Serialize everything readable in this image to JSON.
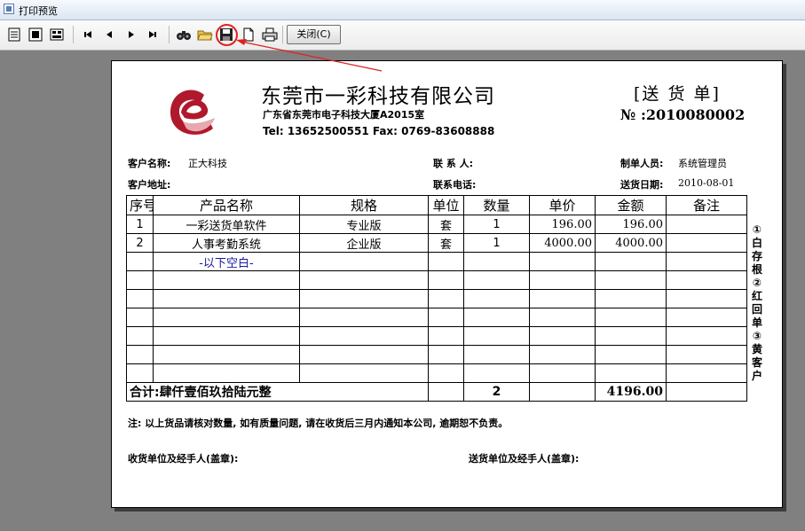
{
  "window": {
    "title": "打印预览"
  },
  "toolbar": {
    "close_label": "关闭(C)",
    "icons": [
      "single-page-icon",
      "two-page-icon",
      "multi-page-icon",
      "first-page-icon",
      "prev-page-icon",
      "next-page-icon",
      "last-page-icon",
      "find-icon",
      "open-folder-icon",
      "save-icon",
      "new-page-icon",
      "printer-icon"
    ]
  },
  "colors": {
    "highlight": "#e02020",
    "logo": "#b0182c",
    "background": "#808080"
  },
  "document": {
    "company_name": "东莞市一彩科技有限公司",
    "company_address": "广东省东莞市电子科技大厦A2015室",
    "company_contact": "Tel:  13652500551   Fax:  0769-83608888",
    "title": "[送 货 单]",
    "number": "№ :2010080002",
    "customer_name_label": "客户名称:",
    "customer_name": "正大科技",
    "contact_label": "联 系 人:",
    "contact_value": "",
    "maker_label": "制单人员:",
    "maker_value": "系统管理员",
    "customer_address_label": "客户地址:",
    "customer_address": "",
    "phone_label": "联系电话:",
    "phone_value": "",
    "date_label": "送货日期:",
    "date_value": "2010-08-01",
    "table": {
      "headers": [
        "序号",
        "产品名称",
        "规格",
        "单位",
        "数量",
        "单价",
        "金额",
        "备注"
      ],
      "rows": [
        [
          "1",
          "一彩送货单软件",
          "专业版",
          "套",
          "1",
          "196.00",
          "196.00",
          ""
        ],
        [
          "2",
          "人事考勤系统",
          "企业版",
          "套",
          "1",
          "4000.00",
          "4000.00",
          ""
        ],
        [
          "",
          "-以下空白-",
          "",
          "",
          "",
          "",
          "",
          ""
        ],
        [
          "",
          "",
          "",
          "",
          "",
          "",
          "",
          ""
        ],
        [
          "",
          "",
          "",
          "",
          "",
          "",
          "",
          ""
        ],
        [
          "",
          "",
          "",
          "",
          "",
          "",
          "",
          ""
        ],
        [
          "",
          "",
          "",
          "",
          "",
          "",
          "",
          ""
        ],
        [
          "",
          "",
          "",
          "",
          "",
          "",
          "",
          ""
        ],
        [
          "",
          "",
          "",
          "",
          "",
          "",
          "",
          ""
        ]
      ],
      "total_label": "合计:肆仟壹佰玖拾陆元整",
      "total_quantity": "2",
      "total_amount": "4196.00"
    },
    "side_copies": [
      "①",
      "白",
      "存",
      "根",
      "②",
      "红",
      "回",
      "单",
      "③",
      "黄",
      "客",
      "户"
    ],
    "note": "注: 以上货品请核对数量, 如有质量问题, 请在收货后三月内通知本公司, 逾期恕不负责。",
    "receiver_sign": "收货单位及经手人(盖章):",
    "sender_sign": "送货单位及经手人(盖章):"
  }
}
